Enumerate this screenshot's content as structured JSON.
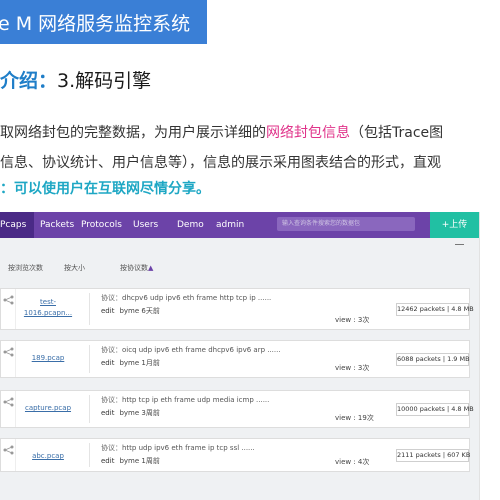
{
  "banner": {
    "title": "e M 网络服务监控系统",
    "color": "#3a7fd6"
  },
  "heading": {
    "prefix": "介绍：",
    "text": "3.解码引擎"
  },
  "intro": {
    "line1_a": "取网络封包的完整数据，为用户展示详细的",
    "line1_highlight": "网络封包信息",
    "line1_b": "（包括Trace图",
    "line2": "信息、协议统计、用户信息等），信息的展示采用图表结合的形式，直观",
    "line3": "：可以使用户在互联网尽情分享。"
  },
  "app": {
    "nav": {
      "items": [
        "Pcaps",
        "Packets",
        "Protocols",
        "Users",
        "Demo"
      ],
      "active": "Pcaps",
      "user": "admin",
      "search_placeholder": "输入查询条件搜索您的数据包",
      "upload_label": "+上传",
      "colors": {
        "bar": "#6c43a8",
        "active": "#4a2a86",
        "upload": "#21c0a3"
      }
    },
    "sort": {
      "by_views": "按浏览次数",
      "by_size": "按大小",
      "by_protocol": "按协议数",
      "arrow": "▲"
    },
    "labels": {
      "protocol": "协议：",
      "edit": "edit"
    },
    "files": [
      {
        "name_lines": [
          "test-",
          "1016.pcapn..."
        ],
        "protocols": "dhcpv6 udp ipv6 eth frame http tcp ip ......",
        "owner": "byme",
        "time": "6天前",
        "views": "view : 3次",
        "stats": "12462 packets | 4.8 MB"
      },
      {
        "name_lines": [
          "189.pcap"
        ],
        "protocols": "oicq udp ipv6 eth frame dhcpv6 ipv6 arp ......",
        "owner": "byme",
        "time": "1月前",
        "views": "view : 3次",
        "stats": "6088 packets | 1.9 MB"
      },
      {
        "name_lines": [
          "capture.pcap"
        ],
        "protocols": "http tcp ip eth frame udp media icmp ......",
        "owner": "byme",
        "time": "3周前",
        "views": "view : 19次",
        "stats": "10000 packets | 4.8 MB"
      },
      {
        "name_lines": [
          "abc.pcap"
        ],
        "protocols": "http udp ipv6 eth frame ip tcp ssl ......",
        "owner": "byme",
        "time": "1周前",
        "views": "view : 4次",
        "stats": "2111 packets | 607 KB"
      }
    ]
  }
}
